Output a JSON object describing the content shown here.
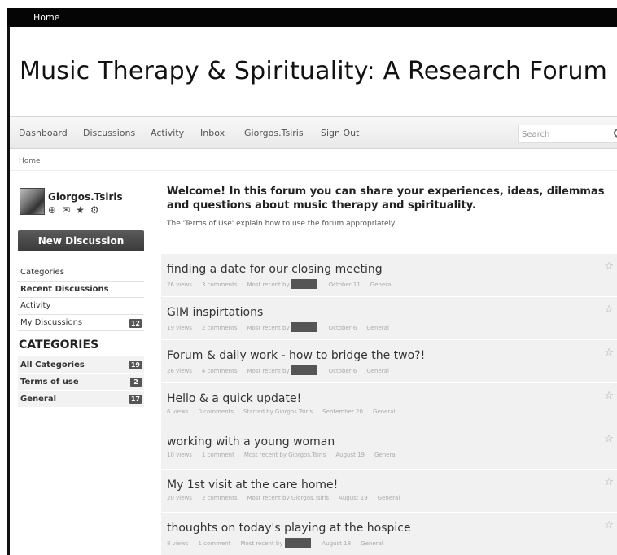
{
  "topbar": {
    "home_label": "Home"
  },
  "site_title": "Music Therapy & Spirituality: A Research Forum",
  "nav": {
    "items": [
      "Dashboard",
      "Discussions",
      "Activity",
      "Inbox",
      "Giorgos.Tsiris",
      "Sign Out"
    ],
    "search_placeholder": "Search"
  },
  "breadcrumb": "Home",
  "user": {
    "name": "Giorgos.Tsiris",
    "icons": [
      "globe-icon",
      "envelope-icon",
      "star-icon",
      "gear-icon"
    ]
  },
  "new_discussion_label": "New Discussion",
  "sidebar": {
    "items": [
      {
        "label": "Categories",
        "bold": false,
        "count": ""
      },
      {
        "label": "Recent Discussions",
        "bold": true,
        "count": ""
      },
      {
        "label": "Activity",
        "bold": false,
        "count": ""
      },
      {
        "label": "My Discussions",
        "bold": false,
        "count": "12"
      }
    ],
    "categories_heading": "CATEGORIES",
    "categories": [
      {
        "label": "All Categories",
        "count": "19"
      },
      {
        "label": "Terms of use",
        "count": "2"
      },
      {
        "label": "General",
        "count": "17"
      }
    ]
  },
  "main": {
    "welcome": "Welcome! In this forum you can share your experiences, ideas, dilemmas and questions about music therapy and spirituality.",
    "terms_note": "The 'Terms of Use' explain how to use the forum appropriately."
  },
  "discussions": [
    {
      "title": "finding a date for our closing meeting",
      "views": "26 views",
      "comments": "3 comments",
      "recent": "Most recent by",
      "redacted": true,
      "date": "October 11",
      "category": "General"
    },
    {
      "title": "GIM inspirtations",
      "views": "19 views",
      "comments": "2 comments",
      "recent": "Most recent by",
      "redacted": true,
      "date": "October 6",
      "category": "General"
    },
    {
      "title": "Forum & daily work - how to bridge the two?!",
      "views": "26 views",
      "comments": "4 comments",
      "recent": "Most recent by",
      "redacted": true,
      "date": "October 6",
      "category": "General"
    },
    {
      "title": "Hello & a quick update!",
      "views": "6 views",
      "comments": "0 comments",
      "recent": "Started by Giorgos.Tsiris",
      "redacted": false,
      "date": "September 20",
      "category": "General"
    },
    {
      "title": "working with a young woman",
      "views": "10 views",
      "comments": "1 comment",
      "recent": "Most recent by Giorgos.Tsiris",
      "redacted": false,
      "date": "August 19",
      "category": "General"
    },
    {
      "title": "My 1st visit at the care home!",
      "views": "20 views",
      "comments": "2 comments",
      "recent": "Most recent by Giorgos.Tsiris",
      "redacted": false,
      "date": "August 19",
      "category": "General"
    },
    {
      "title": "thoughts on today's playing at the hospice",
      "views": "8 views",
      "comments": "1 comment",
      "recent": "Most recent by",
      "redacted": true,
      "date": "August 18",
      "category": "General"
    }
  ]
}
